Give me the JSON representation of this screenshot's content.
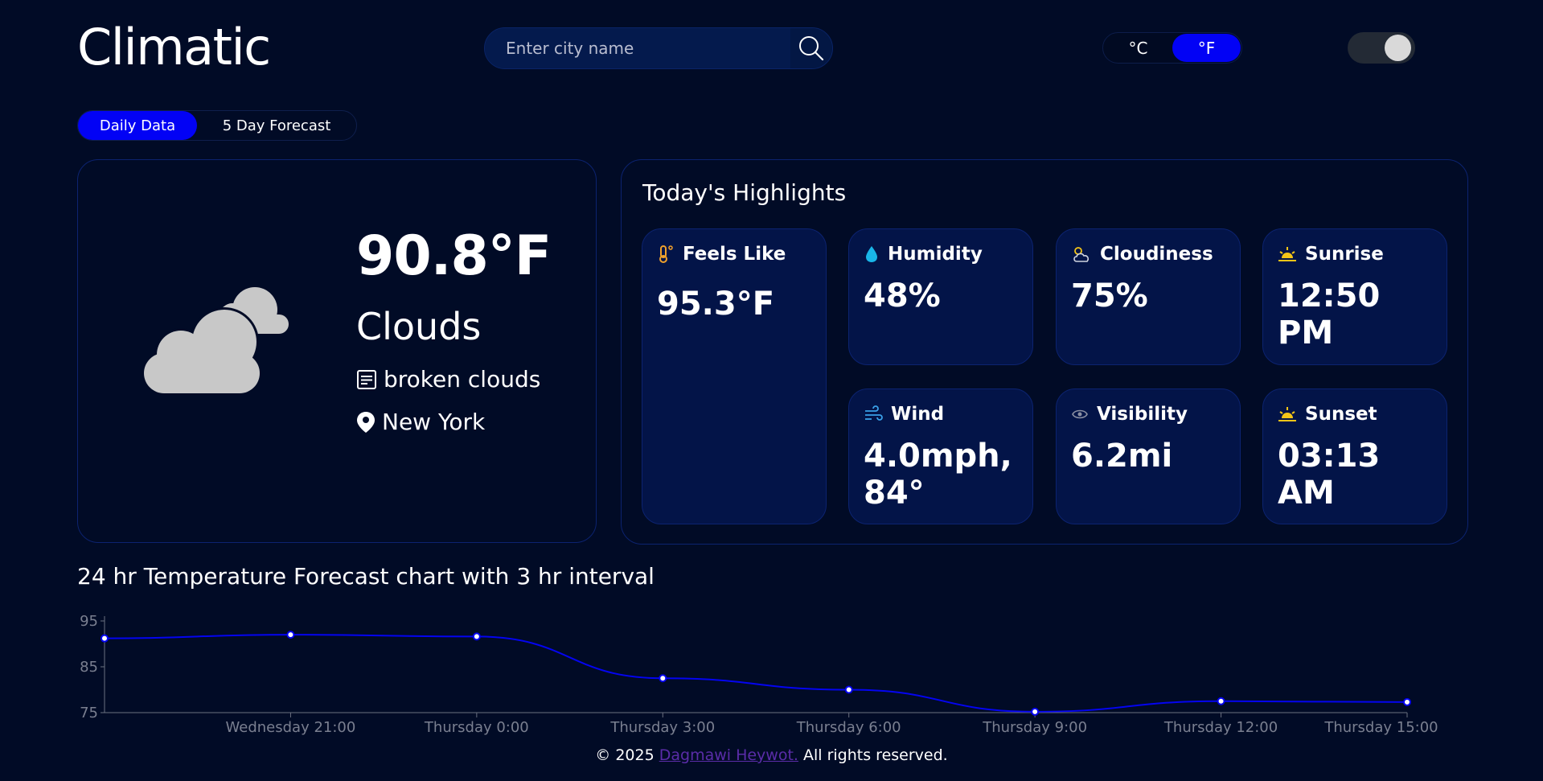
{
  "app": {
    "title": "Climatic"
  },
  "search": {
    "placeholder": "Enter city name"
  },
  "units": {
    "celsius": "°C",
    "fahrenheit": "°F",
    "selected": "°F"
  },
  "tabs": [
    {
      "label": "Daily Data",
      "active": true
    },
    {
      "label": "5 Day Forecast",
      "active": false
    }
  ],
  "current": {
    "temperature": "90.8°F",
    "condition": "Clouds",
    "description": "broken clouds",
    "location": "New York",
    "icon": "cloud-icon"
  },
  "highlights": {
    "title": "Today's Highlights",
    "feels_like": {
      "label": "Feels Like",
      "value": "95.3°F",
      "icon": "thermometer-icon"
    },
    "humidity": {
      "label": "Humidity",
      "value": "48%",
      "icon": "droplet-icon"
    },
    "cloudiness": {
      "label": "Cloudiness",
      "value": "75%",
      "icon": "partly-cloudy-icon"
    },
    "sunrise": {
      "label": "Sunrise",
      "value": "12:50 PM",
      "icon": "sunrise-icon"
    },
    "wind": {
      "label": "Wind",
      "value": "4.0mph, 84°",
      "icon": "wind-icon"
    },
    "visibility": {
      "label": "Visibility",
      "value": "6.2mi",
      "icon": "eye-icon"
    },
    "sunset": {
      "label": "Sunset",
      "value": "03:13 AM",
      "icon": "sunset-icon"
    }
  },
  "chart_title": "24 hr Temperature Forecast chart with 3 hr interval",
  "chart_data": {
    "type": "line",
    "x": [
      "",
      "Wednesday 21:00",
      "Thursday 0:00",
      "Thursday 3:00",
      "Thursday 6:00",
      "Thursday 9:00",
      "Thursday 12:00",
      "Thursday 15:00"
    ],
    "series": [
      {
        "values": [
          91.2,
          92.0,
          91.6,
          82.5,
          80.0,
          75.2,
          77.5,
          77.3
        ]
      }
    ],
    "yticks": [
      75,
      85,
      95
    ],
    "ylim": [
      75,
      95
    ],
    "grid": false,
    "line_color": "#0404f0"
  },
  "footer": {
    "prefix": "© 2025 ",
    "author": "Dagmawi Heywot.",
    "suffix": " All rights reserved."
  }
}
